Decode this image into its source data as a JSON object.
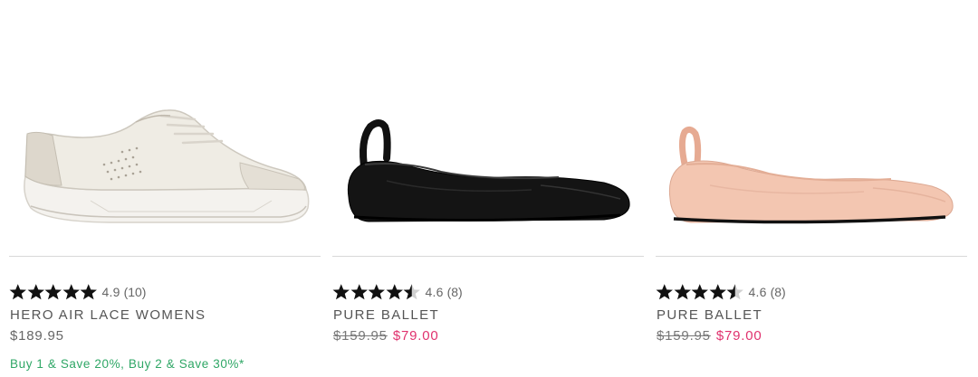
{
  "products": [
    {
      "name": "HERO AIR LACE WOMENS",
      "rating": "4.9",
      "review_count": "(10)",
      "stars": 5,
      "price": "$189.95",
      "promo": "Buy 1 & Save 20%, Buy 2 & Save 30%*",
      "image_color": "#f1efe9",
      "image_icon": "white-sneaker-image"
    },
    {
      "name": "PURE BALLET",
      "rating": "4.6",
      "review_count": "(8)",
      "stars": 4.5,
      "price_was": "$159.95",
      "price_now": "$79.00",
      "image_color": "#111111",
      "image_icon": "black-ballet-flat-image"
    },
    {
      "name": "PURE BALLET",
      "rating": "4.6",
      "review_count": "(8)",
      "stars": 4.5,
      "price_was": "$159.95",
      "price_now": "$79.00",
      "image_color": "#f2c4ad",
      "image_icon": "blush-ballet-flat-image"
    }
  ],
  "colors": {
    "sale_price": "#e0326e",
    "promo_text": "#2fa766",
    "star": "#111111",
    "divider": "#d8d8d8"
  }
}
